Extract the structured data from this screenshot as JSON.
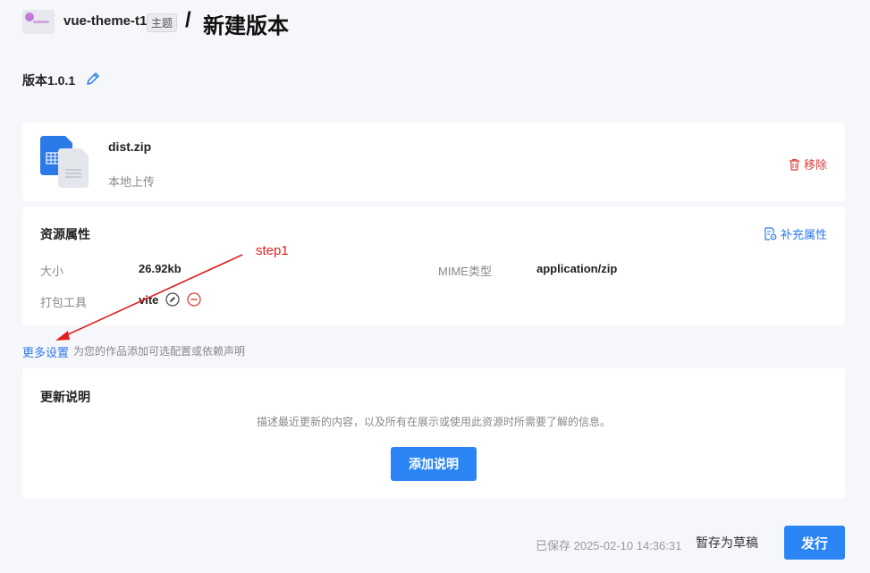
{
  "header": {
    "theme_name": "vue-theme-t1",
    "theme_badge": "主题",
    "separator": "/",
    "page_title": "新建版本"
  },
  "version": {
    "label": "版本1.0.1"
  },
  "file": {
    "name": "dist.zip",
    "source": "本地上传",
    "remove_label": "移除"
  },
  "properties": {
    "title": "资源属性",
    "add_label": "补充属性",
    "size_key": "大小",
    "size_value": "26.92kb",
    "mime_key": "MIME类型",
    "mime_value": "application/zip",
    "tool_key": "打包工具",
    "tool_value": "vite"
  },
  "more_settings": {
    "link_label": "更多设置",
    "hint": "为您的作品添加可选配置或依赖声明"
  },
  "release_notes": {
    "title": "更新说明",
    "description": "描述最近更新的内容，以及所有在展示或使用此资源时所需要了解的信息。",
    "add_button": "添加说明"
  },
  "footer": {
    "saved_text": "已保存 2025-02-10 14:36:31",
    "draft_button": "暂存为草稿",
    "publish_button": "发行"
  },
  "annotation": {
    "step_label": "step1",
    "color": "#e02020"
  },
  "colors": {
    "accent": "#2b85f5",
    "danger": "#e03c3c",
    "link": "#2b7ae8"
  }
}
